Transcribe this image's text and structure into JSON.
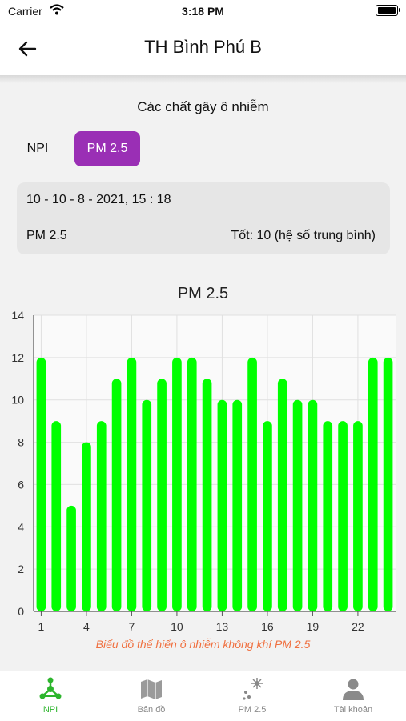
{
  "status_bar": {
    "carrier": "Carrier",
    "time": "3:18 PM"
  },
  "nav": {
    "title": "TH Bình Phú B",
    "back_icon": "arrow-left-icon"
  },
  "pollutants": {
    "heading": "Các chất gây ô nhiễm",
    "tabs": [
      {
        "label": "NPI",
        "selected": false
      },
      {
        "label": "PM 2.5",
        "selected": true
      }
    ]
  },
  "info": {
    "datetime": "10 - 10 - 8 - 2021, 15 : 18",
    "pollutant": "PM 2.5",
    "status": "Tốt: 10 (hệ số trung bình)"
  },
  "colors": {
    "accent": "#9a2fb5",
    "bar": "#00ff00",
    "caption": "#f07040",
    "active_tab": "#2db52d"
  },
  "chart_title": "PM 2.5",
  "chart_data": {
    "type": "bar",
    "title": "PM 2.5",
    "x": [
      1,
      2,
      3,
      4,
      5,
      6,
      7,
      8,
      9,
      10,
      11,
      12,
      13,
      14,
      15,
      16,
      17,
      18,
      19,
      20,
      21,
      22,
      23,
      24
    ],
    "values": [
      12,
      9,
      5,
      8,
      9,
      11,
      12,
      10,
      11,
      12,
      12,
      11,
      10,
      10,
      12,
      9,
      11,
      10,
      10,
      9,
      9,
      9,
      12,
      12
    ],
    "xticks": [
      "1",
      "4",
      "7",
      "10",
      "13",
      "16",
      "19",
      "22"
    ],
    "yticks": [
      "0",
      "2",
      "4",
      "6",
      "8",
      "10",
      "12",
      "14"
    ],
    "ylim": [
      0,
      14
    ],
    "grid": true
  },
  "caption": "Biểu đồ thể hiển ô nhiễm không khí PM 2.5",
  "tabbar": [
    {
      "label": "NPI",
      "icon": "network-icon",
      "active": true
    },
    {
      "label": "Bản đồ",
      "icon": "map-icon",
      "active": false
    },
    {
      "label": "PM 2.5",
      "icon": "particles-icon",
      "active": false
    },
    {
      "label": "Tài khoản",
      "icon": "user-icon",
      "active": false
    }
  ]
}
